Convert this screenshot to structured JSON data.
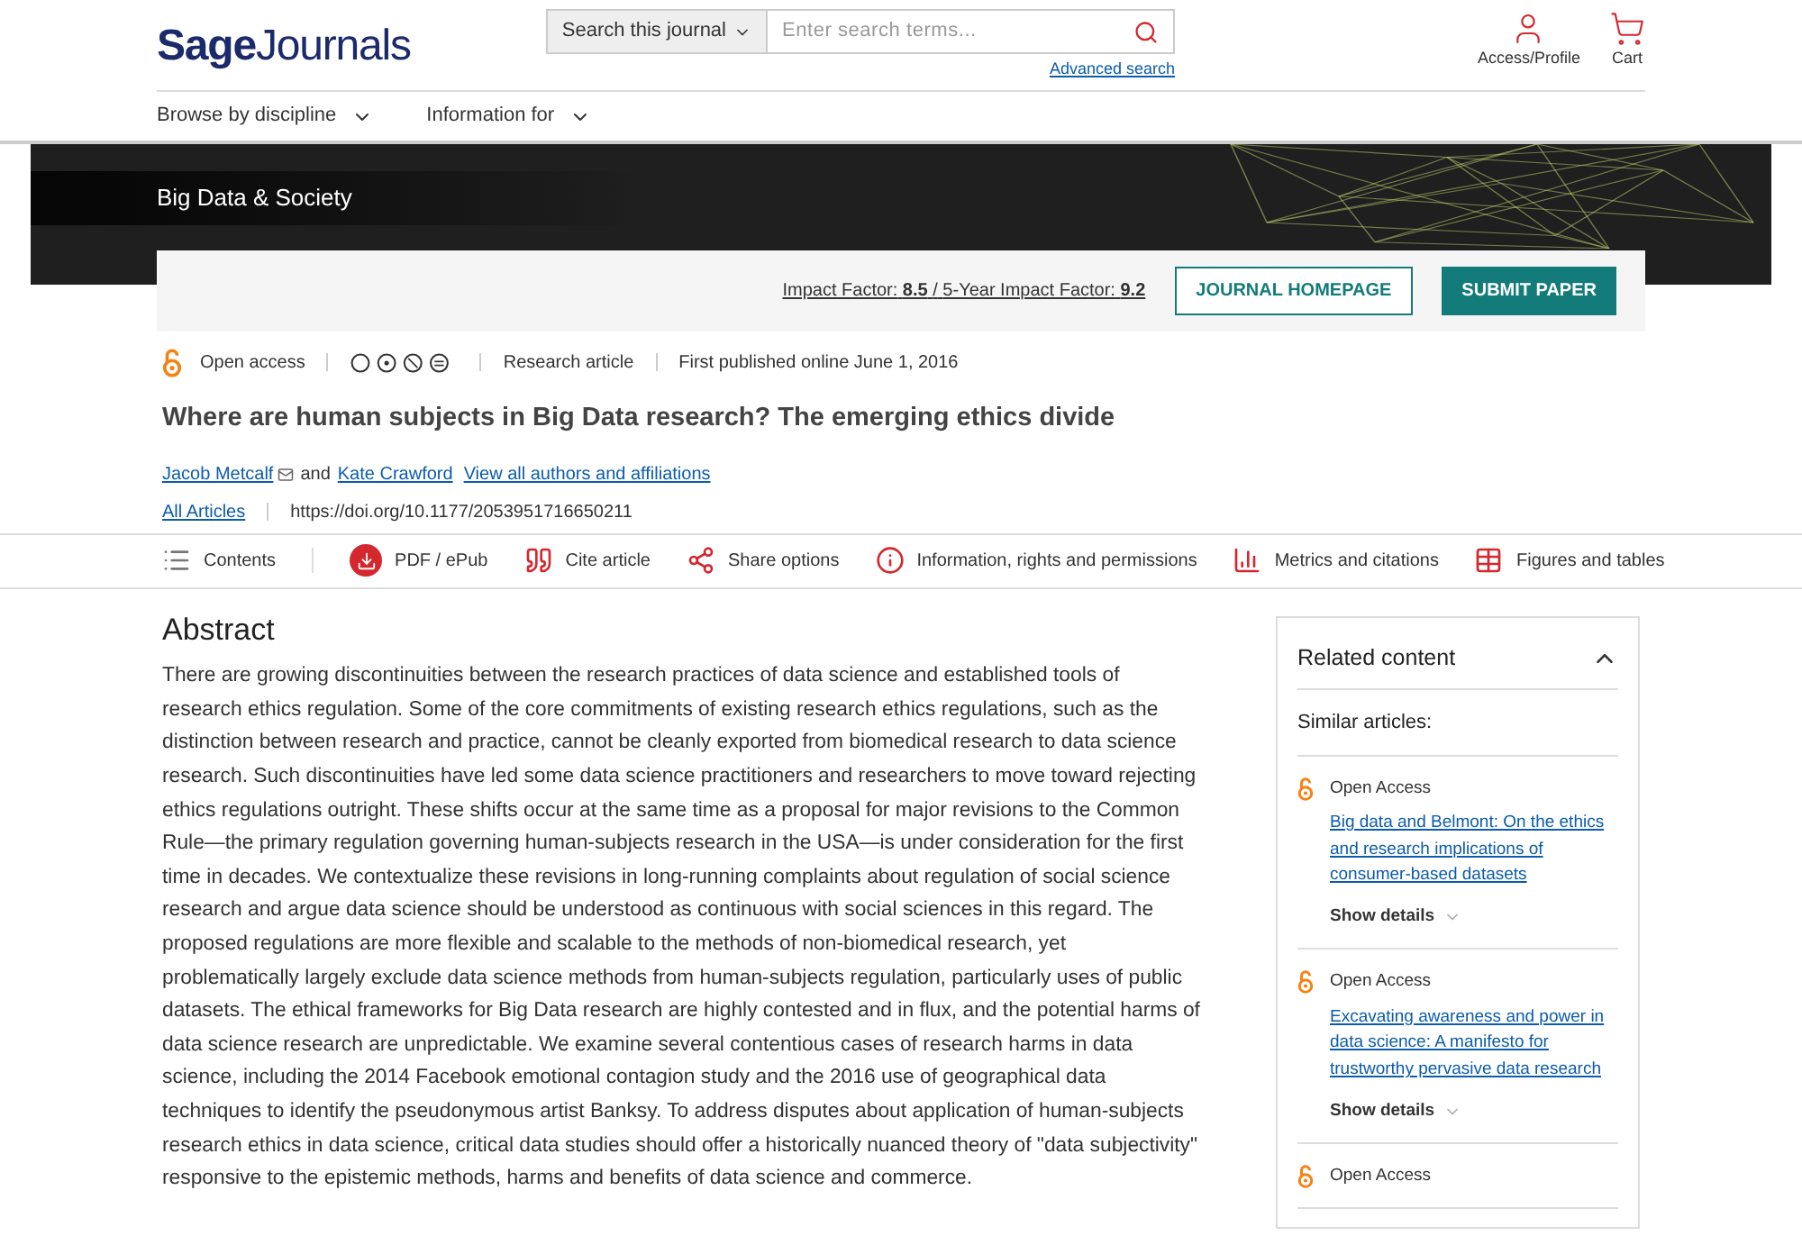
{
  "header": {
    "logo_bold": "Sage",
    "logo_rest": "Journals",
    "search_scope": "Search this journal",
    "search_placeholder": "Enter search terms...",
    "advanced_search": "Advanced search",
    "account": "Access/Profile",
    "cart": "Cart"
  },
  "nav": [
    "Browse by discipline",
    "Information for"
  ],
  "journal": {
    "title": "Big Data & Society",
    "impact_label": "Impact Factor:",
    "impact_value": "8.5",
    "separator": "/",
    "five_year_label": "5-Year Impact Factor:",
    "five_year_value": "9.2",
    "buttons": [
      {
        "label": "JOURNAL HOMEPAGE",
        "kind": "outline"
      },
      {
        "label": "SUBMIT PAPER",
        "kind": "solid"
      }
    ]
  },
  "article": {
    "access": "Open access",
    "type": "Research article",
    "published": "First published online June 1, 2016",
    "title": "Where are human subjects in Big Data research? The emerging ethics divide",
    "authors": [
      {
        "name": "Jacob Metcalf",
        "email": true
      },
      {
        "name": "Kate Crawford",
        "email": false
      }
    ],
    "and": "and",
    "all_authors": "View all authors and affiliations",
    "all_articles": "All Articles",
    "doi": "https://doi.org/10.1177/2053951716650211"
  },
  "tools": [
    {
      "label": "Contents",
      "kind": "contents"
    },
    {
      "label": "PDF / ePub",
      "kind": "pdf"
    },
    {
      "label": "Cite article",
      "kind": "cite"
    },
    {
      "label": "Share options",
      "kind": "share"
    },
    {
      "label": "Information, rights and permissions",
      "kind": "info"
    },
    {
      "label": "Metrics and citations",
      "kind": "metrics"
    },
    {
      "label": "Figures and tables",
      "kind": "figures"
    }
  ],
  "abstract": {
    "heading": "Abstract",
    "text": "There are growing discontinuities between the research practices of data science and established tools of research ethics regulation. Some of the core commitments of existing research ethics regulations, such as the distinction between research and practice, cannot be cleanly exported from biomedical research to data science research. Such discontinuities have led some data science practitioners and researchers to move toward rejecting ethics regulations outright. These shifts occur at the same time as a proposal for major revisions to the Common Rule—the primary regulation governing human-subjects research in the USA—is under consideration for the first time in decades. We contextualize these revisions in long-running complaints about regulation of social science research and argue data science should be understood as continuous with social sciences in this regard. The proposed regulations are more flexible and scalable to the methods of non-biomedical research, yet problematically largely exclude data science methods from human-subjects regulation, particularly uses of public datasets. The ethical frameworks for Big Data research are highly contested and in flux, and the potential harms of data science research are unpredictable. We examine several contentious cases of research harms in data science, including the 2014 Facebook emotional contagion study and the 2016 use of geographical data techniques to identify the pseudonymous artist Banksy. To address disputes about application of human-subjects research ethics in data science, critical data studies should offer a historically nuanced theory of \"data subjectivity\" responsive to the epistemic methods, harms and benefits of data science and commerce."
  },
  "related": {
    "title": "Related content",
    "expanded": true,
    "subtitle": "Similar articles:",
    "items": [
      {
        "access": "Open Access",
        "title": "Big data and Belmont: On the ethics and research implications of consumer-based datasets",
        "details": "Show details"
      },
      {
        "access": "Open Access",
        "title": "Excavating awareness and power in data science: A manifesto for trustworthy pervasive data research",
        "details": "Show details"
      },
      {
        "access": "Open Access"
      }
    ]
  }
}
